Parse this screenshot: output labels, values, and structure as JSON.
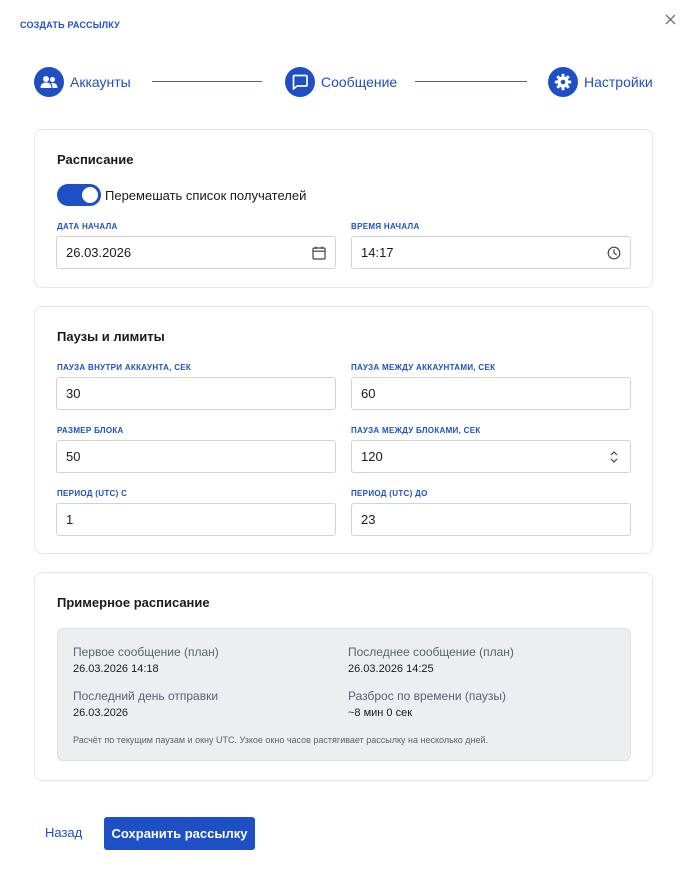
{
  "dialog": {
    "title": "СОЗДАТЬ РАССЫЛКУ"
  },
  "steps": [
    {
      "label": "Аккаунты",
      "icon": "users-icon"
    },
    {
      "label": "Сообщение",
      "icon": "chat-bubble-icon"
    },
    {
      "label": "Настройки",
      "icon": "gear-icon"
    }
  ],
  "schedule": {
    "title": "Расписание",
    "shuffle": {
      "label": "Перемешать список получателей",
      "checked": true
    },
    "start_date": {
      "label": "ДАТА НАЧАЛА",
      "value": "26.03.2026"
    },
    "start_time": {
      "label": "ВРЕМЯ НАЧАЛА",
      "value": "14:17"
    }
  },
  "limits": {
    "title": "Паузы и лимиты",
    "pause_in_account": {
      "label": "ПАУЗА ВНУТРИ АККАУНТА, СЕК",
      "value": "30"
    },
    "pause_between_accounts": {
      "label": "ПАУЗА МЕЖДУ АККАУНТАМИ, СЕК",
      "value": "60"
    },
    "block_size": {
      "label": "РАЗМЕР БЛОКА",
      "value": "50"
    },
    "pause_between_blocks": {
      "label": "ПАУЗА МЕЖДУ БЛОКАМИ, СЕК",
      "value": "120"
    },
    "period_from": {
      "label": "ПЕРИОД (UTC) С",
      "value": "1"
    },
    "period_to": {
      "label": "ПЕРИОД (UTC) ДО",
      "value": "23"
    }
  },
  "estimate": {
    "title": "Примерное расписание",
    "first_message": {
      "label": "Первое сообщение (план)",
      "value": "26.03.2026 14:18"
    },
    "last_message": {
      "label": "Последнее сообщение (план)",
      "value": "26.03.2026 14:25"
    },
    "last_day": {
      "label": "Последний день отправки",
      "value": "26.03.2026"
    },
    "spread": {
      "label": "Разброс по времени (паузы)",
      "value": "~8 мин 0 сек"
    },
    "note": "Расчёт по текущим паузам и окну UTC. Узкое окно часов растягивает рассылку на несколько дней."
  },
  "actions": {
    "back": "Назад",
    "save": "Сохранить рассылку"
  },
  "colors": {
    "accent": "#1f4fc4",
    "muted": "#5a6173",
    "summary_bg": "#eceef0"
  }
}
